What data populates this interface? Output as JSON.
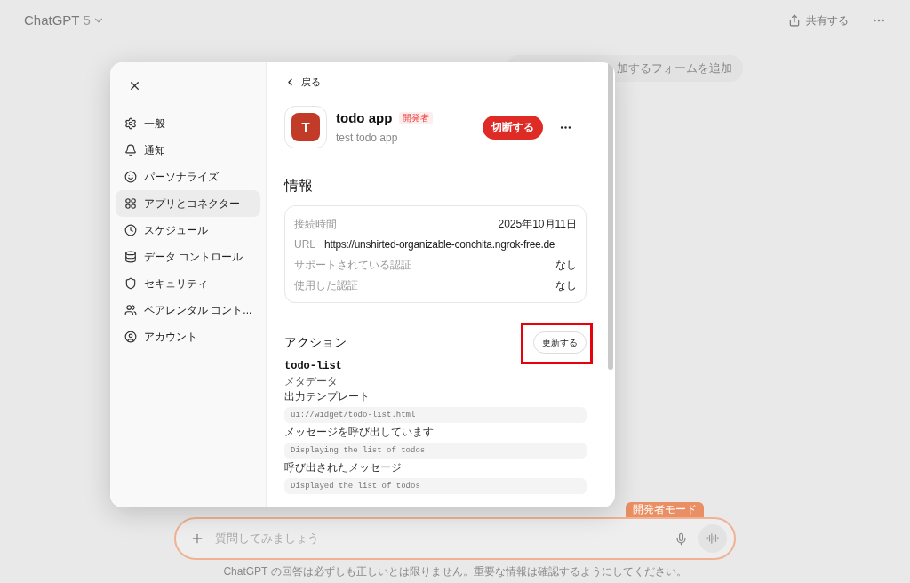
{
  "header": {
    "title": "ChatGPT",
    "model": "5",
    "share": "共有する"
  },
  "chat": {
    "bubble": "加するフォームを追加"
  },
  "settings": {
    "nav": [
      {
        "label": "一般",
        "selected": false
      },
      {
        "label": "通知",
        "selected": false
      },
      {
        "label": "パーソナライズ",
        "selected": false
      },
      {
        "label": "アプリとコネクター",
        "selected": true
      },
      {
        "label": "スケジュール",
        "selected": false
      },
      {
        "label": "データ コントロール",
        "selected": false
      },
      {
        "label": "セキュリティ",
        "selected": false
      },
      {
        "label": "ペアレンタル コント...",
        "selected": false
      },
      {
        "label": "アカウント",
        "selected": false
      }
    ],
    "back": "戻る",
    "app": {
      "initial": "T",
      "name": "todo app",
      "badge": "開発者",
      "description": "test todo app",
      "disconnect": "切断する"
    },
    "info": {
      "title": "情報",
      "rows": [
        {
          "kind": "pair",
          "label": "接続時間",
          "value": "2025年10月11日"
        },
        {
          "kind": "inline",
          "label": "URL",
          "value": "https://unshirted-organizable-conchita.ngrok-free.de"
        },
        {
          "kind": "pair",
          "label": "サポートされている認証",
          "value": "なし"
        },
        {
          "kind": "pair",
          "label": "使用した認証",
          "value": "なし"
        }
      ]
    },
    "actions": {
      "title": "アクション",
      "refresh": {
        "label": "更新する",
        "highlighted": true
      },
      "name": "todo-list",
      "meta": "メタデータ",
      "fields": [
        {
          "label": "出力テンプレート",
          "value": "ui://widget/todo-list.html"
        },
        {
          "label": "メッセージを呼び出しています",
          "value": "Displaying the list of todos"
        },
        {
          "label": "呼び出されたメッセージ",
          "value": "Displayed the list of todos"
        }
      ]
    }
  },
  "composer": {
    "badge": "開発者モード",
    "placeholder": "質問してみましょう"
  },
  "disclaimer": "ChatGPT の回答は必ずしも正しいとは限りません。重要な情報は確認するようにしてください。"
}
